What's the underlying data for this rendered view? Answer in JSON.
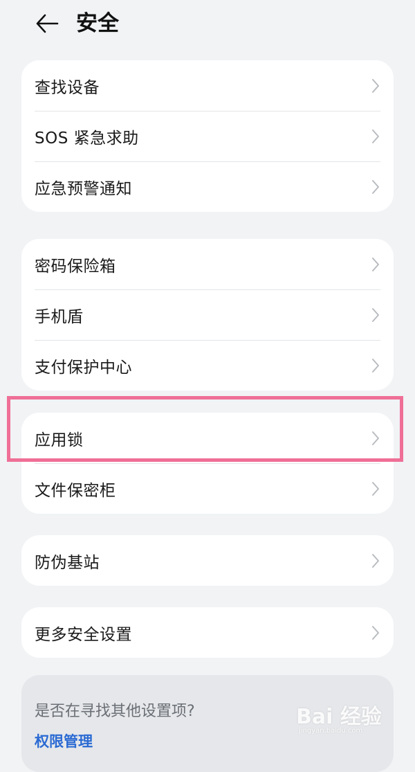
{
  "header": {
    "back_icon": "arrow-left-icon",
    "title": "安全"
  },
  "groups": [
    {
      "items": [
        {
          "label": "查找设备"
        },
        {
          "label": "SOS 紧急求助"
        },
        {
          "label": "应急预警通知"
        }
      ]
    },
    {
      "items": [
        {
          "label": "密码保险箱"
        },
        {
          "label": "手机盾"
        },
        {
          "label": "支付保护中心"
        }
      ]
    },
    {
      "items": [
        {
          "label": "应用锁"
        },
        {
          "label": "文件保密柜"
        }
      ]
    },
    {
      "items": [
        {
          "label": "防伪基站"
        }
      ]
    },
    {
      "items": [
        {
          "label": "更多安全设置"
        }
      ]
    }
  ],
  "hint": {
    "question": "是否在寻找其他设置项?",
    "link": "权限管理"
  },
  "watermark": {
    "logo": "Bai 经验",
    "sub": "jingyan.baidu.com"
  },
  "colors": {
    "background": "#f1f3f5",
    "card": "#ffffff",
    "highlight": "#ef6f97",
    "link": "#2a6ad3"
  }
}
